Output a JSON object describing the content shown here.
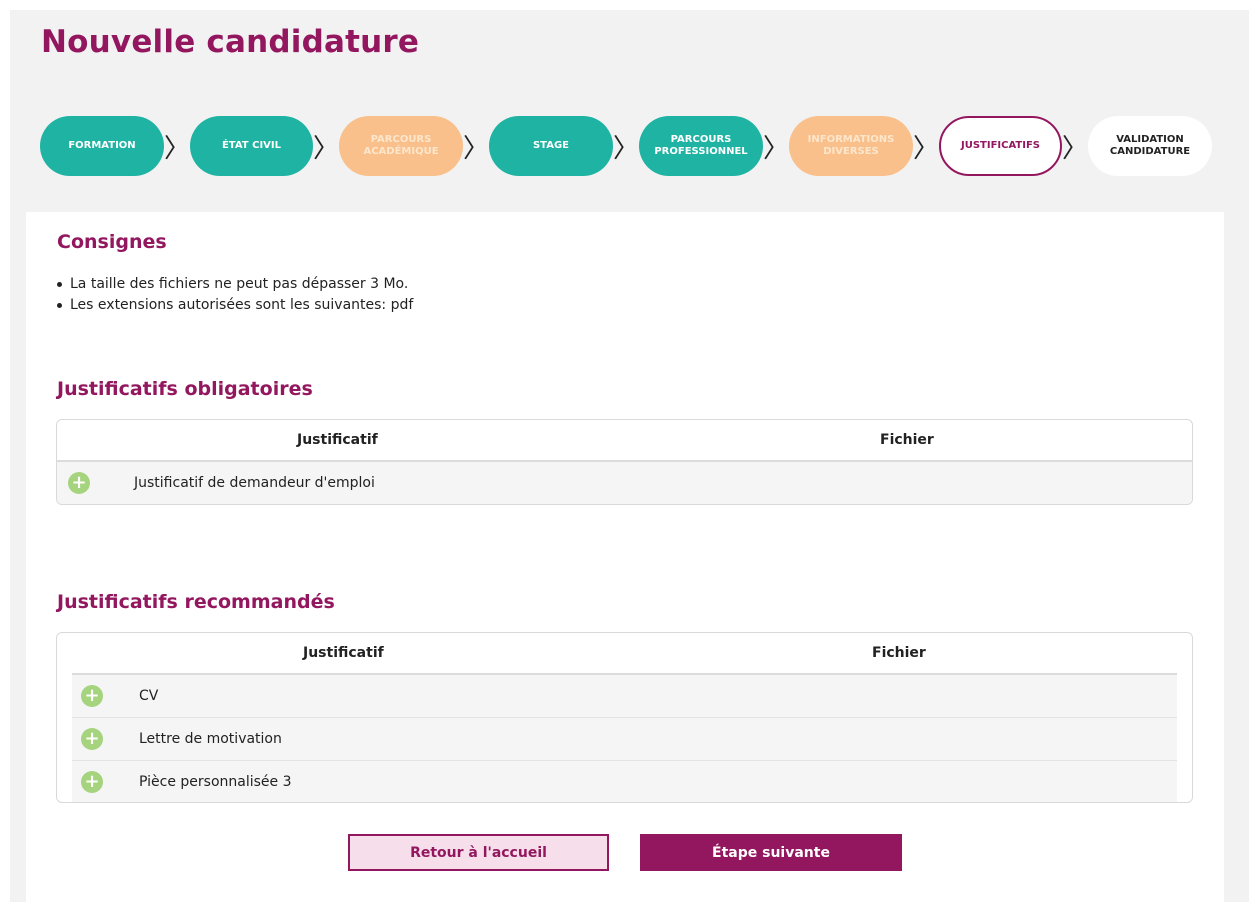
{
  "page": {
    "title": "Nouvelle candidature"
  },
  "stepper": [
    {
      "line1": "FORMATION",
      "line2": "",
      "state": "done"
    },
    {
      "line1": "ÉTAT CIVIL",
      "line2": "",
      "state": "done"
    },
    {
      "line1": "PARCOURS",
      "line2": "ACADÉMIQUE",
      "state": "partial"
    },
    {
      "line1": "STAGE",
      "line2": "",
      "state": "done"
    },
    {
      "line1": "PARCOURS",
      "line2": "PROFESSIONNEL",
      "state": "done"
    },
    {
      "line1": "INFORMATIONS",
      "line2": "DIVERSES",
      "state": "partial"
    },
    {
      "line1": "JUSTIFICATIFS",
      "line2": "",
      "state": "active"
    },
    {
      "line1": "VALIDATION",
      "line2": "CANDIDATURE",
      "state": "upcoming"
    }
  ],
  "separator": "〉",
  "consignes": {
    "title": "Consignes",
    "items": [
      "La taille des fichiers ne peut pas dépasser 3 Mo.",
      "Les extensions autorisées sont les suivantes: pdf"
    ]
  },
  "mandatory": {
    "title": "Justificatifs obligatoires",
    "col_justificatif": "Justificatif",
    "col_fichier": "Fichier",
    "rows": [
      {
        "label": "Justificatif de demandeur d'emploi"
      }
    ]
  },
  "recommended": {
    "title": "Justificatifs recommandés",
    "col_justificatif": "Justificatif",
    "col_fichier": "Fichier",
    "rows": [
      {
        "label": "CV"
      },
      {
        "label": "Lettre de motivation"
      },
      {
        "label": "Pièce personnalisée 3"
      }
    ]
  },
  "actions": {
    "back_label": "Retour à l'accueil",
    "next_label": "Étape suivante"
  },
  "icons": {
    "add": "plus-circle-icon",
    "chevron": "chevron-right-icon"
  },
  "colors": {
    "brand": "#93175f",
    "step_done": "#1fb3a3",
    "step_partial": "#f9c08c",
    "add_icon": "#a6d37d"
  }
}
